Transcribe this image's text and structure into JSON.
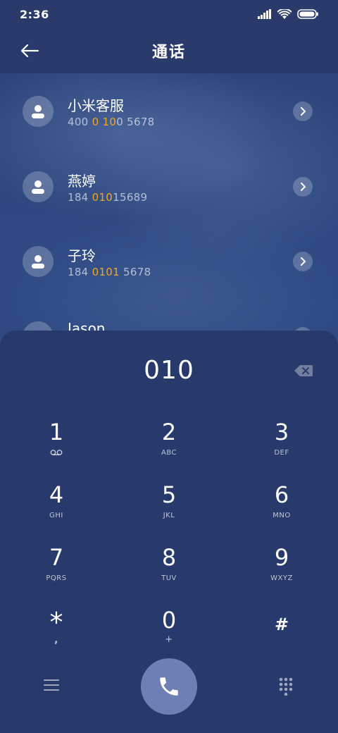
{
  "status_bar": {
    "time": "2:36"
  },
  "header": {
    "title": "通话"
  },
  "contacts": [
    {
      "name": "小米客服",
      "number_parts": [
        {
          "t": "400 ",
          "h": false
        },
        {
          "t": "0",
          "h": true
        },
        {
          "t": " ",
          "h": false
        },
        {
          "t": "10",
          "h": true
        },
        {
          "t": "0 5678",
          "h": false
        }
      ]
    },
    {
      "name": "燕婷",
      "number_parts": [
        {
          "t": "184 ",
          "h": false
        },
        {
          "t": "010",
          "h": true
        },
        {
          "t": "15689",
          "h": false
        }
      ]
    },
    {
      "name": "子玲",
      "number_parts": [
        {
          "t": "184 ",
          "h": false
        },
        {
          "t": "0101",
          "h": true
        },
        {
          "t": " 5678",
          "h": false
        }
      ]
    },
    {
      "name": "Jason",
      "number_parts": []
    }
  ],
  "dialer": {
    "number": "010",
    "keys": [
      {
        "digit": "1",
        "letters": ""
      },
      {
        "digit": "2",
        "letters": "ABC"
      },
      {
        "digit": "3",
        "letters": "DEF"
      },
      {
        "digit": "4",
        "letters": "GHI"
      },
      {
        "digit": "5",
        "letters": "JKL"
      },
      {
        "digit": "6",
        "letters": "MNO"
      },
      {
        "digit": "7",
        "letters": "PQRS"
      },
      {
        "digit": "8",
        "letters": "TUV"
      },
      {
        "digit": "9",
        "letters": "WXYZ"
      },
      {
        "digit": "*",
        "letters": ","
      },
      {
        "digit": "0",
        "letters": "+"
      },
      {
        "digit": "#",
        "letters": ""
      }
    ]
  },
  "colors": {
    "highlight": "#f4a623",
    "call_button": "#6d7fb3",
    "background": "#2a3a6b"
  }
}
